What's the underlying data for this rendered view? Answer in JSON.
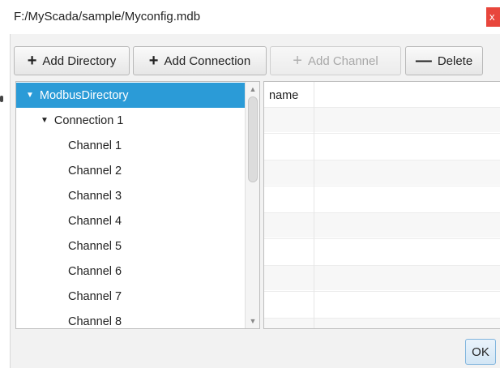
{
  "window": {
    "title": "F:/MyScada/sample/Myconfig.mdb",
    "close_glyph": "x"
  },
  "toolbar": {
    "add_directory": {
      "icon": "plus-icon",
      "glyph": "+",
      "label": "Add Directory"
    },
    "add_connection": {
      "icon": "plus-icon",
      "glyph": "+",
      "label": "Add Connection"
    },
    "add_channel": {
      "icon": "plus-icon",
      "glyph": "+",
      "label": "Add Channel",
      "disabled": true
    },
    "delete": {
      "icon": "minus-icon",
      "glyph": "—",
      "label": "Delete"
    }
  },
  "tree": {
    "items": [
      {
        "label": "ModbusDirectory",
        "expanded": true,
        "selected": true
      },
      {
        "label": "Connection 1",
        "expanded": true
      },
      {
        "label": "Channel 1"
      },
      {
        "label": "Channel 2"
      },
      {
        "label": "Channel 3"
      },
      {
        "label": "Channel 4"
      },
      {
        "label": "Channel 5"
      },
      {
        "label": "Channel 6"
      },
      {
        "label": "Channel 7"
      },
      {
        "label": "Channel 8"
      }
    ],
    "expand_glyph": "▼",
    "scroll_up_glyph": "▲",
    "scroll_down_glyph": "▼"
  },
  "properties_table": {
    "columns": [
      "name",
      ""
    ]
  },
  "footer": {
    "ok_label": "OK"
  },
  "colors": {
    "selection": "#2b9bd7",
    "close": "#e8463c",
    "ok_border": "#7fb4dd"
  }
}
